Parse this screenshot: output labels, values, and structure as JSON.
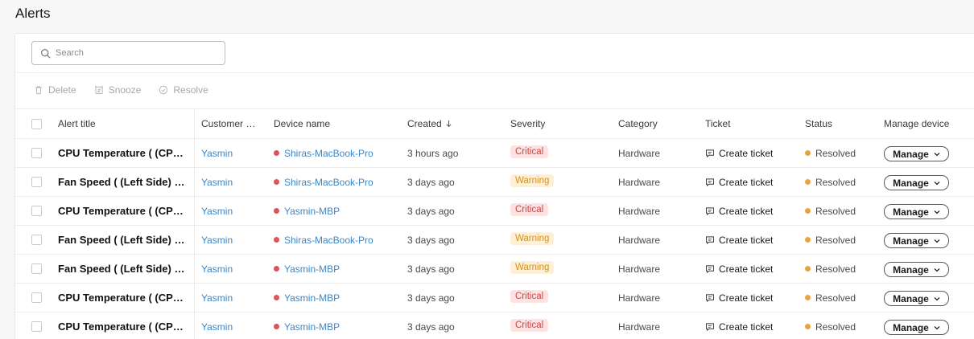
{
  "page": {
    "title": "Alerts"
  },
  "search": {
    "placeholder": "Search",
    "value": ""
  },
  "toolbar": {
    "delete_label": "Delete",
    "snooze_label": "Snooze",
    "resolve_label": "Resolve"
  },
  "table": {
    "headers": {
      "alert_title": "Alert title",
      "customer_name": "Customer name",
      "device_name": "Device name",
      "created": "Created",
      "severity": "Severity",
      "category": "Category",
      "ticket": "Ticket",
      "status": "Status",
      "manage_device": "Manage device"
    },
    "rows": [
      {
        "title": "CPU Temperature ( (CPU_...",
        "customer": "Yasmin",
        "device": "Shiras-MacBook-Pro",
        "created": "3 hours ago",
        "severity": "Critical",
        "category": "Hardware",
        "ticket": "Create ticket",
        "status": "Resolved",
        "manage": "Manage"
      },
      {
        "title": "Fan Speed ( (Left Side) an...",
        "customer": "Yasmin",
        "device": "Shiras-MacBook-Pro",
        "created": "3 days ago",
        "severity": "Warning",
        "category": "Hardware",
        "ticket": "Create ticket",
        "status": "Resolved",
        "manage": "Manage"
      },
      {
        "title": "CPU Temperature ( (CPU_...",
        "customer": "Yasmin",
        "device": "Yasmin-MBP",
        "created": "3 days ago",
        "severity": "Critical",
        "category": "Hardware",
        "ticket": "Create ticket",
        "status": "Resolved",
        "manage": "Manage"
      },
      {
        "title": "Fan Speed ( (Left Side) an...",
        "customer": "Yasmin",
        "device": "Shiras-MacBook-Pro",
        "created": "3 days ago",
        "severity": "Warning",
        "category": "Hardware",
        "ticket": "Create ticket",
        "status": "Resolved",
        "manage": "Manage"
      },
      {
        "title": "Fan Speed ( (Left Side) an...",
        "customer": "Yasmin",
        "device": "Yasmin-MBP",
        "created": "3 days ago",
        "severity": "Warning",
        "category": "Hardware",
        "ticket": "Create ticket",
        "status": "Resolved",
        "manage": "Manage"
      },
      {
        "title": "CPU Temperature ( (CPU_...",
        "customer": "Yasmin",
        "device": "Yasmin-MBP",
        "created": "3 days ago",
        "severity": "Critical",
        "category": "Hardware",
        "ticket": "Create ticket",
        "status": "Resolved",
        "manage": "Manage"
      },
      {
        "title": "CPU Temperature ( (CPU_...",
        "customer": "Yasmin",
        "device": "Yasmin-MBP",
        "created": "3 days ago",
        "severity": "Critical",
        "category": "Hardware",
        "ticket": "Create ticket",
        "status": "Resolved",
        "manage": "Manage"
      }
    ]
  },
  "colors": {
    "link": "#3b87c9",
    "device_dot": "#e0525a",
    "status_dot": "#e8a33c",
    "critical_bg": "#fde2e1",
    "critical_text": "#d9423f",
    "warning_bg": "#fdf0d4",
    "warning_text": "#d98f1a"
  },
  "icons": {
    "search": "search-icon",
    "delete": "trash-icon",
    "snooze": "alarm-clock-icon",
    "resolve": "check-circle-icon",
    "sort": "arrow-down-icon",
    "ticket": "message-square-icon",
    "manage": "chevron-down-icon"
  }
}
